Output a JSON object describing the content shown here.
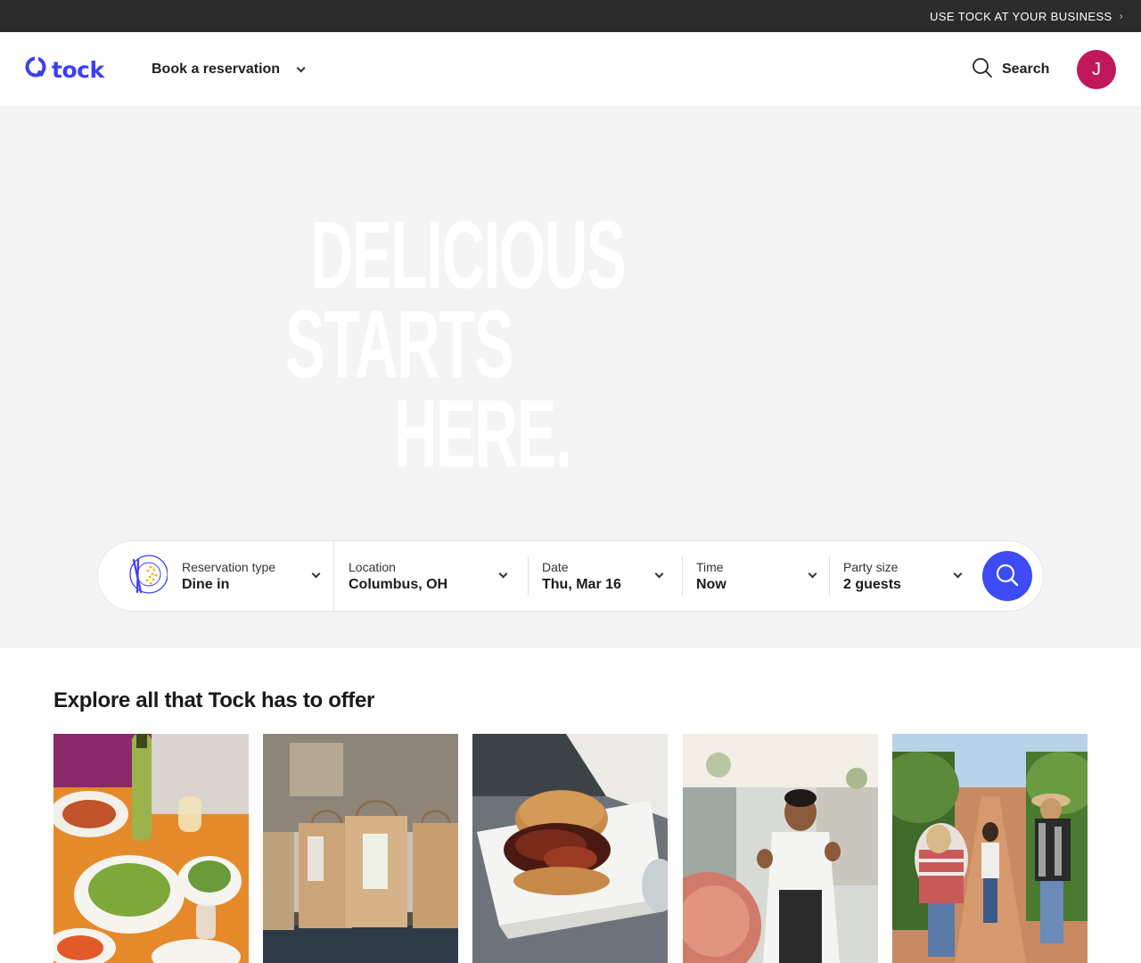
{
  "promo": {
    "text": "USE TOCK AT YOUR BUSINESS",
    "chevron": "›"
  },
  "header": {
    "logo_text": "tock",
    "logo_icon": "tock-logo-icon",
    "book_menu": "Book a reservation",
    "search_label": "Search",
    "avatar_initial": "J"
  },
  "hero": {
    "line1": "DELICIOUS",
    "line2": "STARTS",
    "line3": "HERE."
  },
  "search": {
    "reservation_type": {
      "label": "Reservation type",
      "value": "Dine in"
    },
    "location": {
      "label": "Location",
      "value": "Columbus, OH"
    },
    "date": {
      "label": "Date",
      "value": "Thu, Mar 16"
    },
    "time": {
      "label": "Time",
      "value": "Now"
    },
    "party_size": {
      "label": "Party size",
      "value": "2 guests"
    }
  },
  "explore": {
    "title": "Explore all that Tock has to offer",
    "cards": [
      {
        "name": "dine-in"
      },
      {
        "name": "takeout-bags"
      },
      {
        "name": "burger-to-go"
      },
      {
        "name": "chef-experience"
      },
      {
        "name": "winery-vineyard"
      }
    ]
  },
  "colors": {
    "brand": "#3d3ef5",
    "search_button": "#3d4bf5",
    "avatar": "#c2185b",
    "promo_bar": "#2b2b2b",
    "hero_bg": "#f4f4f4"
  }
}
